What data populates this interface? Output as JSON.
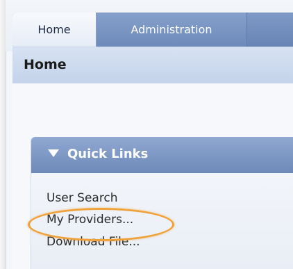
{
  "tabs": [
    {
      "label": "Home",
      "active": true
    },
    {
      "label": "Administration",
      "active": false
    }
  ],
  "page": {
    "title": "Home"
  },
  "panel": {
    "title": "Quick Links",
    "links": [
      {
        "label": "User Search"
      },
      {
        "label": "My Providers..."
      },
      {
        "label": "Download File..."
      }
    ],
    "highlighted_link_index": 1
  },
  "colors": {
    "tab_active_bg": "#eef3fa",
    "tabbar_bg": "#7390bf",
    "panel_header_bg": "#7f98c5",
    "highlight": "#f0a23a"
  },
  "icons": {
    "panel_collapse": "triangle-down-icon"
  }
}
